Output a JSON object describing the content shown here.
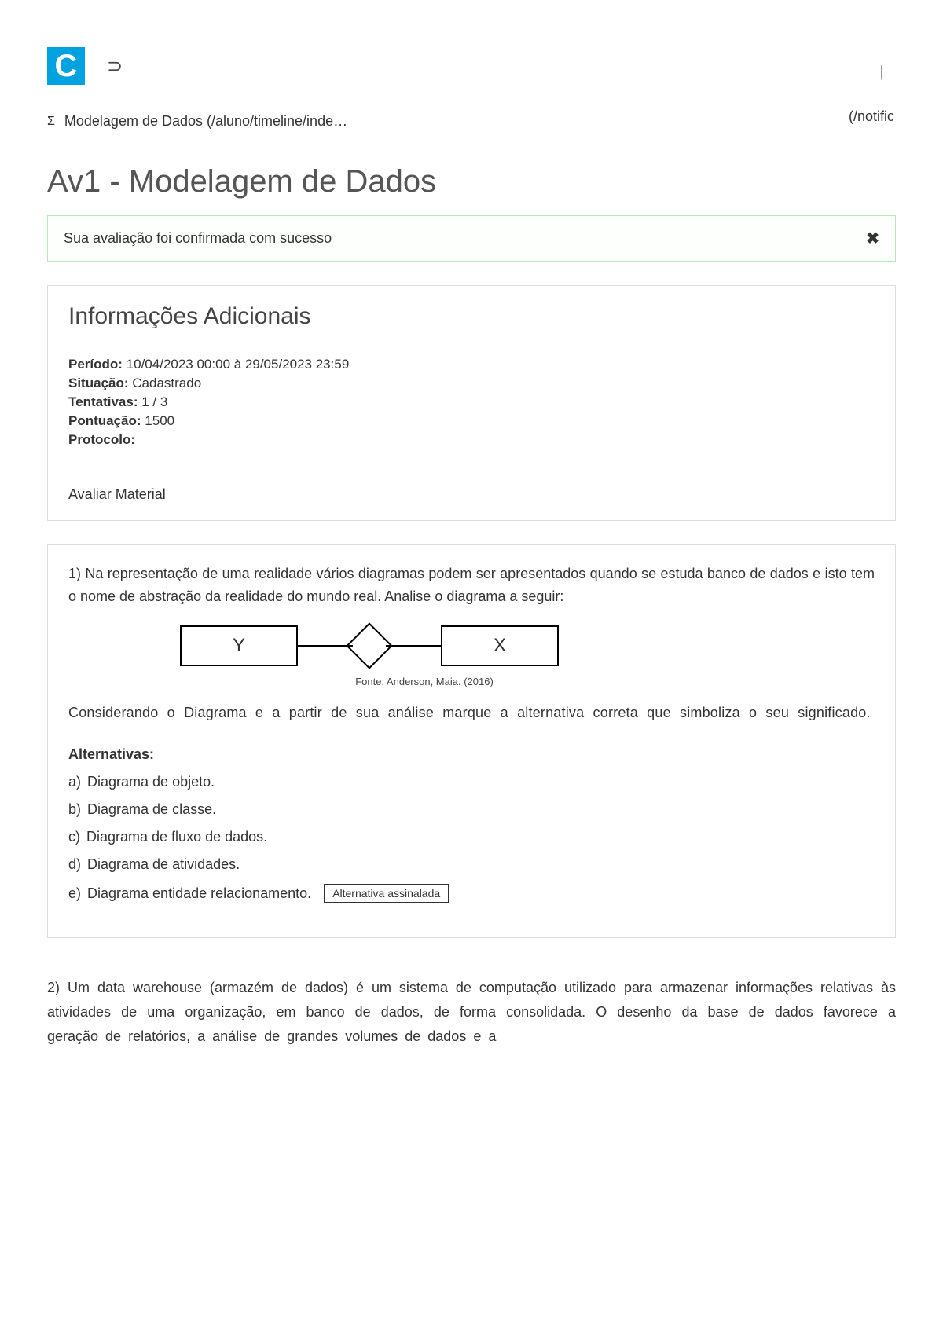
{
  "header": {
    "logo_letter": "C",
    "superset_glyph": "⊃",
    "top_right_bar": "|",
    "notific_text": "(/notific"
  },
  "breadcrumb": {
    "sigma_glyph": "Σ",
    "text": "Modelagem de Dados (/aluno/timeline/inde…"
  },
  "title": "Av1 - Modelagem de Dados",
  "alert": {
    "text": "Sua avaliação foi confirmada com sucesso",
    "close_glyph": "✖"
  },
  "info": {
    "heading": "Informações Adicionais",
    "periodo_label": "Período:",
    "periodo_value": " 10/04/2023 00:00 à 29/05/2023 23:59",
    "situacao_label": "Situação:",
    "situacao_value": " Cadastrado",
    "tentativas_label": "Tentativas:",
    "tentativas_value": " 1 / 3",
    "pontuacao_label": "Pontuação:",
    "pontuacao_value": " 1500",
    "protocolo_label": "Protocolo:",
    "protocolo_value": "",
    "avaliar": "Avaliar Material"
  },
  "q1": {
    "number": "1)",
    "text_a": " Na representação de uma realidade vários diagramas podem ser apresentados quando se estuda banco de dados e isto tem o nome de abstração da realidade do mundo real. Analise o diagrama a seguir:",
    "entity_y": "Y",
    "entity_x": "X",
    "caption": "Fonte: Anderson, Maia. (2016)",
    "text_b": "Considerando o Diagrama e a partir de sua análise marque a alternativa correta que simboliza o seu significado.",
    "alt_heading": "Alternativas:",
    "alts": [
      {
        "letter": "a)",
        "text": " Diagrama de objeto."
      },
      {
        "letter": "b)",
        "text": " Diagrama de classe."
      },
      {
        "letter": "c)",
        "text": " Diagrama de fluxo de dados."
      },
      {
        "letter": "d)",
        "text": " Diagrama de atividades."
      },
      {
        "letter": "e)",
        "text": " Diagrama entidade relacionamento."
      }
    ],
    "selected_index": 4,
    "selected_badge": "Alternativa assinalada"
  },
  "q2": {
    "number": "2)",
    "text": "   Um data warehouse (armazém de dados) é um sistema de computação utilizado para armazenar informações relativas às atividades de uma organização, em banco de dados, de forma consolidada. O desenho da base de dados favorece a geração de relatórios, a análise de grandes volumes de dados e a"
  }
}
